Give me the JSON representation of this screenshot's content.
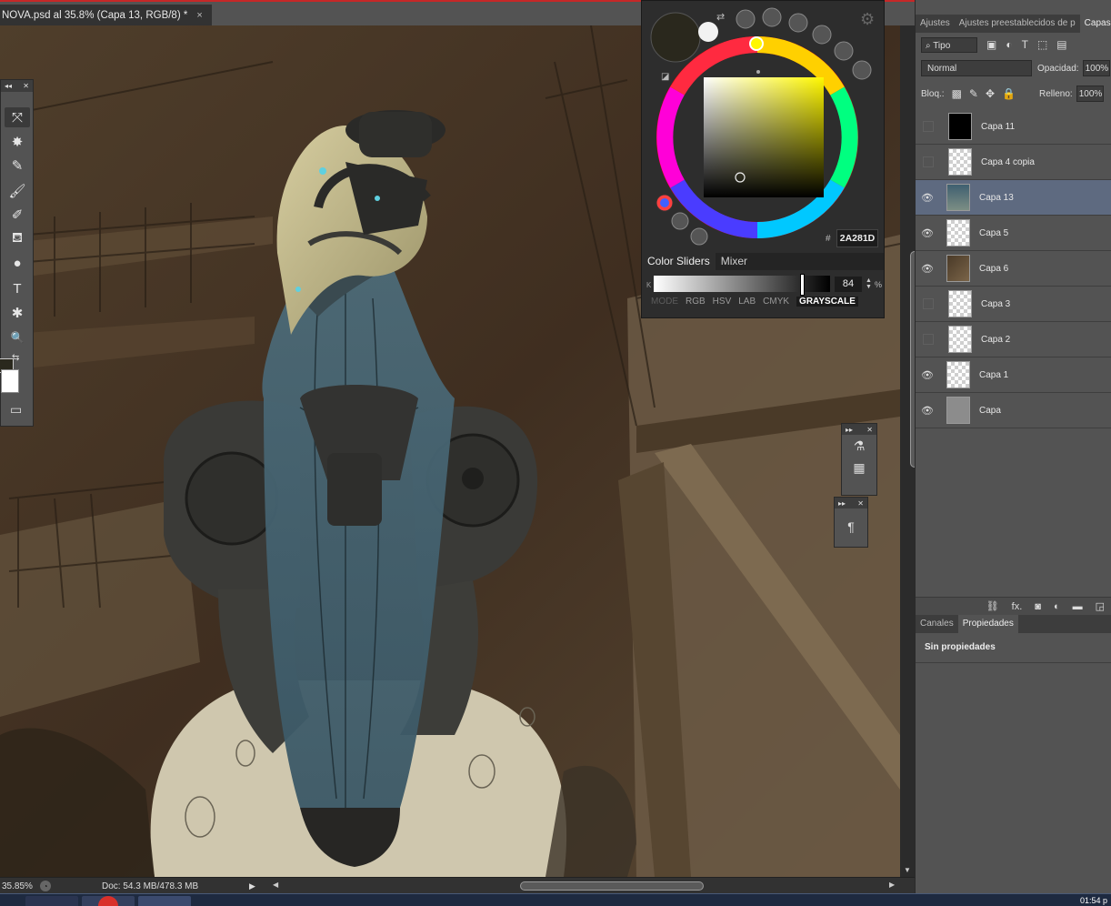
{
  "document": {
    "tab_title": "NOVA.psd al 35.8% (Capa 13, RGB/8) *",
    "close_glyph": "×"
  },
  "status": {
    "zoom": "35.85%",
    "doc_info": "Doc: 54.3 MB/478.3 MB"
  },
  "toolbar": {
    "tools": [
      {
        "name": "move-tool",
        "glyph": "⤧",
        "active": true
      },
      {
        "name": "magic-wand-tool",
        "glyph": "✸"
      },
      {
        "name": "eyedropper-tool",
        "glyph": "✎"
      },
      {
        "name": "brush-tool",
        "glyph": "🖌"
      },
      {
        "name": "history-brush-tool",
        "glyph": "✐"
      },
      {
        "name": "paint-bucket-tool",
        "glyph": "⛾"
      },
      {
        "name": "dodge-tool",
        "glyph": "●"
      },
      {
        "name": "type-tool",
        "glyph": "T"
      },
      {
        "name": "custom-shape-tool",
        "glyph": "✱"
      },
      {
        "name": "zoom-tool",
        "glyph": "🔍"
      }
    ],
    "foreground_color": "#2a281d",
    "background_color": "#ffffff"
  },
  "color_panel": {
    "hex_prefix": "#",
    "hex_value": "2A281D",
    "current_color": "#2a281d",
    "hue_color": "#fff700",
    "tabs": [
      {
        "label": "Color Sliders",
        "active": true
      },
      {
        "label": "Mixer",
        "active": false
      }
    ],
    "k_label": "K",
    "k_value": "84",
    "k_unit": "%",
    "modes_label": "MODE",
    "modes": [
      {
        "label": "RGB",
        "active": false
      },
      {
        "label": "HSV",
        "active": false
      },
      {
        "label": "LAB",
        "active": false
      },
      {
        "label": "CMYK",
        "active": false
      },
      {
        "label": "GRAYSCALE",
        "active": true
      }
    ]
  },
  "right_panel": {
    "tabs": [
      {
        "label": "Ajustes",
        "active": false
      },
      {
        "label": "Ajustes preestablecidos de p",
        "active": false
      },
      {
        "label": "Capas",
        "active": true
      }
    ],
    "filter_label": "⌕ Tipo",
    "blend_mode": "Normal",
    "opacity_label": "Opacidad:",
    "opacity_value": "100%",
    "lock_label": "Bloq.:",
    "fill_label": "Relleno:",
    "fill_value": "100%",
    "layers": [
      {
        "name": "Capa 11",
        "visible": false,
        "thumb": "black",
        "selected": false
      },
      {
        "name": "Capa 4 copia",
        "visible": false,
        "thumb": "check",
        "selected": false
      },
      {
        "name": "Capa 13",
        "visible": true,
        "thumb": "fig",
        "selected": true
      },
      {
        "name": "Capa 5",
        "visible": true,
        "thumb": "check",
        "selected": false
      },
      {
        "name": "Capa 6",
        "visible": true,
        "thumb": "scene",
        "selected": false
      },
      {
        "name": "Capa 3",
        "visible": false,
        "thumb": "check",
        "selected": false
      },
      {
        "name": "Capa 2",
        "visible": false,
        "thumb": "check",
        "selected": false
      },
      {
        "name": "Capa 1",
        "visible": true,
        "thumb": "check",
        "selected": false
      },
      {
        "name": "Capa",
        "visible": true,
        "thumb": "gray",
        "selected": false
      }
    ],
    "props_tabs": [
      {
        "label": "Canales",
        "active": false
      },
      {
        "label": "Propiedades",
        "active": true
      }
    ],
    "no_properties": "Sin propiedades"
  },
  "taskbar": {
    "clock": "01:54 p"
  }
}
